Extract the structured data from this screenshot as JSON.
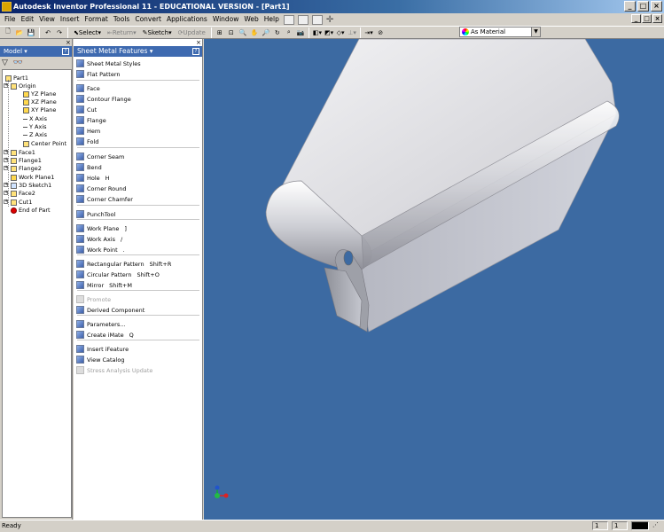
{
  "window": {
    "title": "Autodesk Inventor Professional 11 - EDUCATIONAL VERSION - [Part1]",
    "min": "_",
    "max": "□",
    "close": "×"
  },
  "menu": [
    "File",
    "Edit",
    "View",
    "Insert",
    "Format",
    "Tools",
    "Convert",
    "Applications",
    "Window",
    "Web",
    "Help"
  ],
  "toolbar": {
    "select_label": "Select",
    "return_label": "Return",
    "sketch_label": "Sketch",
    "update_label": "Update",
    "material_value": "As Material"
  },
  "model_browser": {
    "title": "Model",
    "items": [
      {
        "label": "Part1",
        "icon": "part-icon"
      },
      {
        "label": "Origin",
        "icon": "folder-icon"
      },
      {
        "label": "YZ Plane",
        "icon": "plane-icon"
      },
      {
        "label": "XZ Plane",
        "icon": "plane-icon"
      },
      {
        "label": "XY Plane",
        "icon": "plane-icon"
      },
      {
        "label": "X Axis",
        "icon": "axis-icon"
      },
      {
        "label": "Y Axis",
        "icon": "axis-icon"
      },
      {
        "label": "Z Axis",
        "icon": "axis-icon"
      },
      {
        "label": "Center Point",
        "icon": "point-icon"
      },
      {
        "label": "Face1",
        "icon": "face-icon"
      },
      {
        "label": "Flange1",
        "icon": "flange-icon"
      },
      {
        "label": "Flange2",
        "icon": "flange-icon"
      },
      {
        "label": "Work Plane1",
        "icon": "plane-icon"
      },
      {
        "label": "3D Sketch1",
        "icon": "sketch-icon"
      },
      {
        "label": "Face2",
        "icon": "face-icon"
      },
      {
        "label": "Cut1",
        "icon": "cut-icon"
      },
      {
        "label": "End of Part",
        "icon": "end-of-part-icon"
      }
    ]
  },
  "panel_bar": {
    "title": "Sheet Metal Features",
    "commands": [
      {
        "label": "Sheet Metal Styles",
        "shortcut": "",
        "enabled": true
      },
      {
        "label": "Flat Pattern",
        "shortcut": "",
        "enabled": true
      },
      {
        "label": "Face",
        "shortcut": "",
        "enabled": true
      },
      {
        "label": "Contour Flange",
        "shortcut": "",
        "enabled": true
      },
      {
        "label": "Cut",
        "shortcut": "",
        "enabled": true
      },
      {
        "label": "Flange",
        "shortcut": "",
        "enabled": true
      },
      {
        "label": "Hem",
        "shortcut": "",
        "enabled": true
      },
      {
        "label": "Fold",
        "shortcut": "",
        "enabled": true
      },
      {
        "label": "Corner Seam",
        "shortcut": "",
        "enabled": true
      },
      {
        "label": "Bend",
        "shortcut": "",
        "enabled": true
      },
      {
        "label": "Hole",
        "shortcut": "H",
        "enabled": true
      },
      {
        "label": "Corner Round",
        "shortcut": "",
        "enabled": true
      },
      {
        "label": "Corner Chamfer",
        "shortcut": "",
        "enabled": true
      },
      {
        "label": "PunchTool",
        "shortcut": "",
        "enabled": true
      },
      {
        "label": "Work Plane",
        "shortcut": "]",
        "enabled": true
      },
      {
        "label": "Work Axis",
        "shortcut": "/",
        "enabled": true
      },
      {
        "label": "Work Point",
        "shortcut": ".",
        "enabled": true
      },
      {
        "label": "Rectangular Pattern",
        "shortcut": "Shift+R",
        "enabled": true
      },
      {
        "label": "Circular Pattern",
        "shortcut": "Shift+O",
        "enabled": true
      },
      {
        "label": "Mirror",
        "shortcut": "Shift+M",
        "enabled": true
      },
      {
        "label": "Promote",
        "shortcut": "",
        "enabled": false
      },
      {
        "label": "Derived Component",
        "shortcut": "",
        "enabled": true
      },
      {
        "label": "Parameters...",
        "shortcut": "",
        "enabled": true
      },
      {
        "label": "Create iMate",
        "shortcut": "Q",
        "enabled": true
      },
      {
        "label": "Insert iFeature",
        "shortcut": "",
        "enabled": true
      },
      {
        "label": "View Catalog",
        "shortcut": "",
        "enabled": true
      },
      {
        "label": "Stress Analysis Update",
        "shortcut": "",
        "enabled": false
      }
    ]
  },
  "status": {
    "text": "Ready",
    "box1": "1",
    "box2": "1"
  }
}
